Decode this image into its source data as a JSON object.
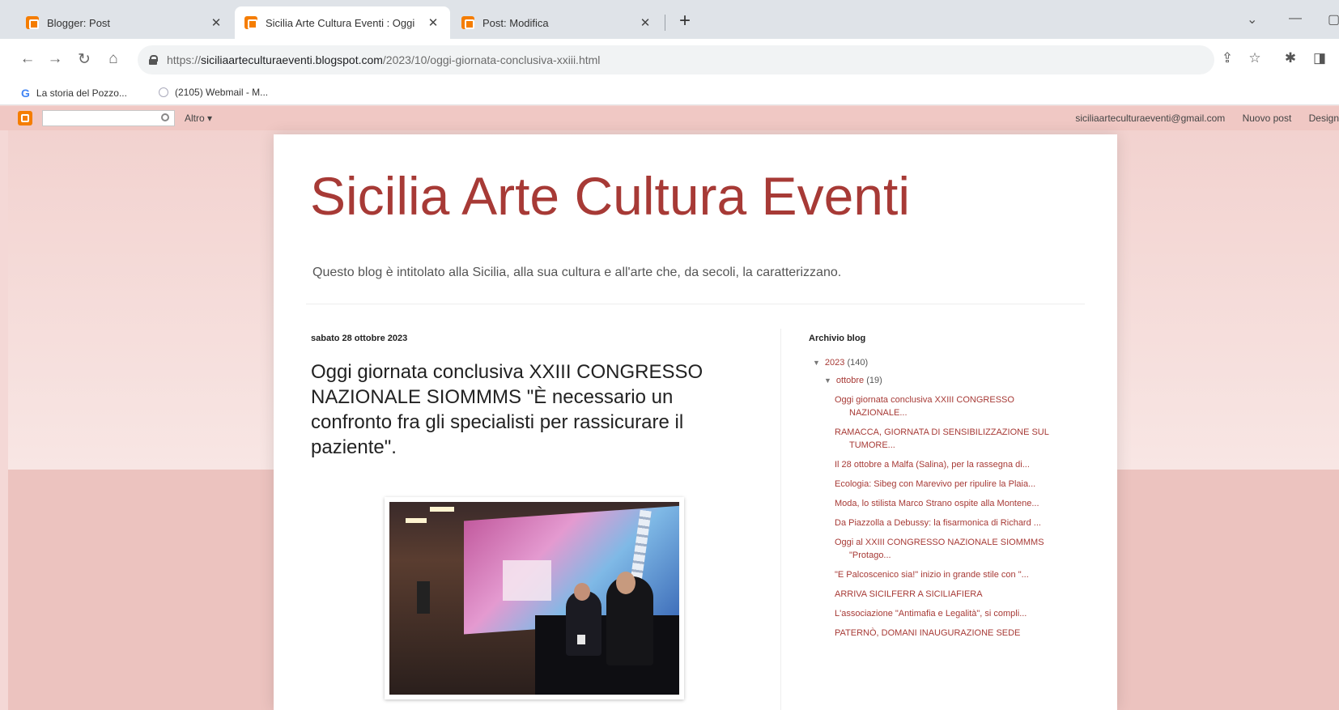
{
  "browser": {
    "tabs": [
      {
        "title": "Blogger: Post",
        "active": false
      },
      {
        "title": "Sicilia Arte Cultura Eventi : Oggi",
        "active": true
      },
      {
        "title": "Post: Modifica",
        "active": false
      }
    ],
    "url": {
      "scheme": "https://",
      "host": "siciliaarteculturaeventi.blogspot.com",
      "path": "/2023/10/oggi-giornata-conclusiva-xxiii.html"
    },
    "bookmarks": [
      {
        "label": "La storia del Pozzo..."
      },
      {
        "label": "(2105) Webmail - M..."
      }
    ]
  },
  "navbar": {
    "more_label": "Altro ▾",
    "email": "siciliaarteculturaeventi@gmail.com",
    "new_post": "Nuovo post",
    "design": "Design"
  },
  "blog": {
    "title": "Sicilia Arte Cultura Eventi",
    "description": "Questo blog è intitolato alla Sicilia, alla sua cultura e all'arte che, da secoli, la caratterizzano."
  },
  "post": {
    "date": "sabato 28 ottobre 2023",
    "title": "Oggi giornata conclusiva XXIII CONGRESSO NAZIONALE SIOMMMS \"È necessario un confronto fra gli specialisti per rassicurare il paziente\"."
  },
  "sidebar": {
    "title": "Archivio blog",
    "year": {
      "label": "2023",
      "count": "(140)"
    },
    "month": {
      "label": "ottobre",
      "count": "(19)"
    },
    "posts": [
      "Oggi giornata conclusiva XXIII CONGRESSO NAZIONALE...",
      "RAMACCA, GIORNATA DI SENSIBILIZZAZIONE SUL TUMORE...",
      "Il 28 ottobre a Malfa (Salina), per la rassegna di...",
      "Ecologia: Sibeg con Marevivo per ripulire la Plaia...",
      "Moda, lo stilista Marco Strano ospite alla Montene...",
      "Da Piazzolla a Debussy: la fisarmonica di Richard ...",
      "Oggi al XXIII CONGRESSO NAZIONALE SIOMMMS \"Protago...",
      "\"E Palcoscenico sia!\" inizio in grande stile con \"...",
      "ARRIVA SICILFERR A SICILIAFIERA",
      "L'associazione \"Antimafia e Legalità\", si compli...",
      "PATERNÒ, DOMANI INAUGURAZIONE SEDE"
    ]
  }
}
